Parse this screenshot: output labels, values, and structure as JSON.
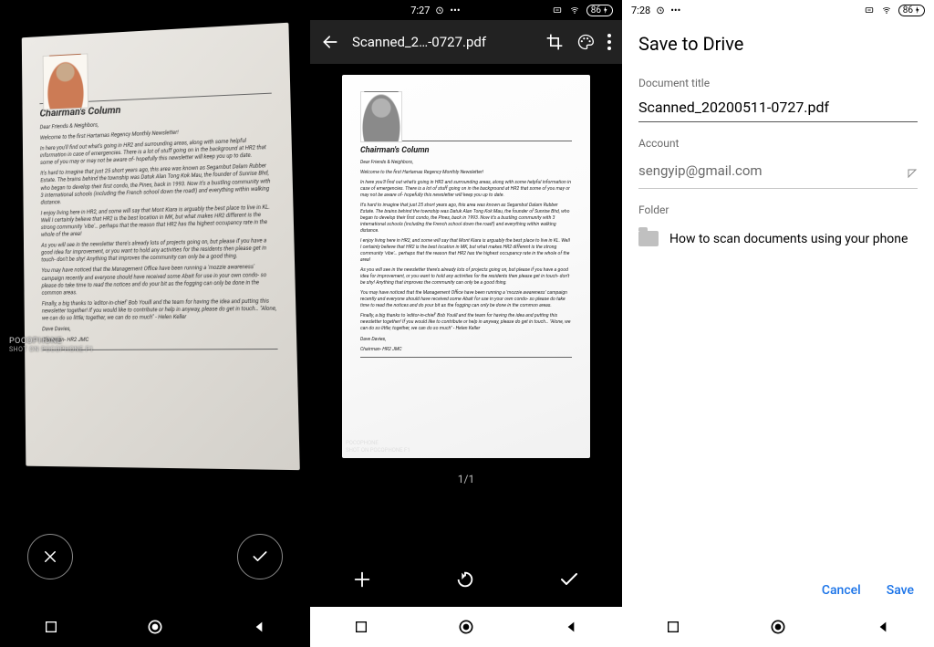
{
  "panel1": {
    "watermark_main": "POCOPHONE",
    "watermark_sub": "SHOT ON POCOPHONE F1",
    "document": {
      "title": "Chairman's Column",
      "greeting": "Dear Friends & Neighbors,",
      "welcome": "Welcome to the first Hartamas Regency Monthly Newsletter!",
      "p1": "In here you'll find out what's going in HR2 and surrounding areas, along with some helpful information in case of emergencies. There is a lot of stuff going on in the background at HR2 that some of you may or may not be aware of- hopefully this newsletter will keep you up to date.",
      "p2": "It's hard to imagine that just 25 short years ago, this area was known as Segambut Dalam Rubber Estate. The brains behind the township was Datuk Alan Tong Kok Mau, the founder of Sunrise Bhd, who began to develop their first condo, the Pines, back in 1993. Now it's a bustling community with 3 international schools (including the French school down the road!) and everything within walking distance.",
      "p3": "I enjoy living here in HR2, and some will say that Mont Kiara is arguably the best place to live in KL. Well I certainly believe that HR2 is the best location in MK, but what makes HR2 different is the strong community 'vibe'… perhaps that the reason that HR2 has the highest occupancy rate in the whole of the area!",
      "p4": "As you will see in the newsletter there's already lots of projects going on, but please if you have a good idea for improvement, or you want to hold any activities for the residents then please get in touch- don't be shy! Anything that improves the community can only be a good thing.",
      "p5": "You may have noticed that the Management Office have been running a 'mozzie awareness' campaign recently and everyone should have received some Abait for use in your own condo- so please do take time to read the notices and do your bit as the fogging can only be done in the common areas.",
      "p6": "Finally, a big thanks to 'editor-in-chief' Bob Youill and the team for having the idea and putting this newsletter together! If you would like to contribute or help in anyway, please do get in touch… \"Alone, we can do so little; together, we can do so much\" - Helen Keller",
      "sig1": "Dave Davies,",
      "sig2": "Chairman- HR2 JMC"
    }
  },
  "panel2": {
    "status_time": "7:27",
    "battery": "86",
    "appbar_title": "Scanned_2…-0727.pdf",
    "page_indicator": "1/1",
    "watermark_main": "POCOPHONE",
    "watermark_sub": "SHOT ON POCOPHONE F1"
  },
  "panel3": {
    "status_time": "7:28",
    "battery": "86",
    "header": "Save to Drive",
    "labels": {
      "doc_title": "Document title",
      "account": "Account",
      "folder": "Folder"
    },
    "doc_title_value": "Scanned_20200511-0727.pdf",
    "account_value": "sengyip@gmail.com",
    "folder_value": "How to scan documents using your phone",
    "actions": {
      "cancel": "Cancel",
      "save": "Save"
    }
  }
}
